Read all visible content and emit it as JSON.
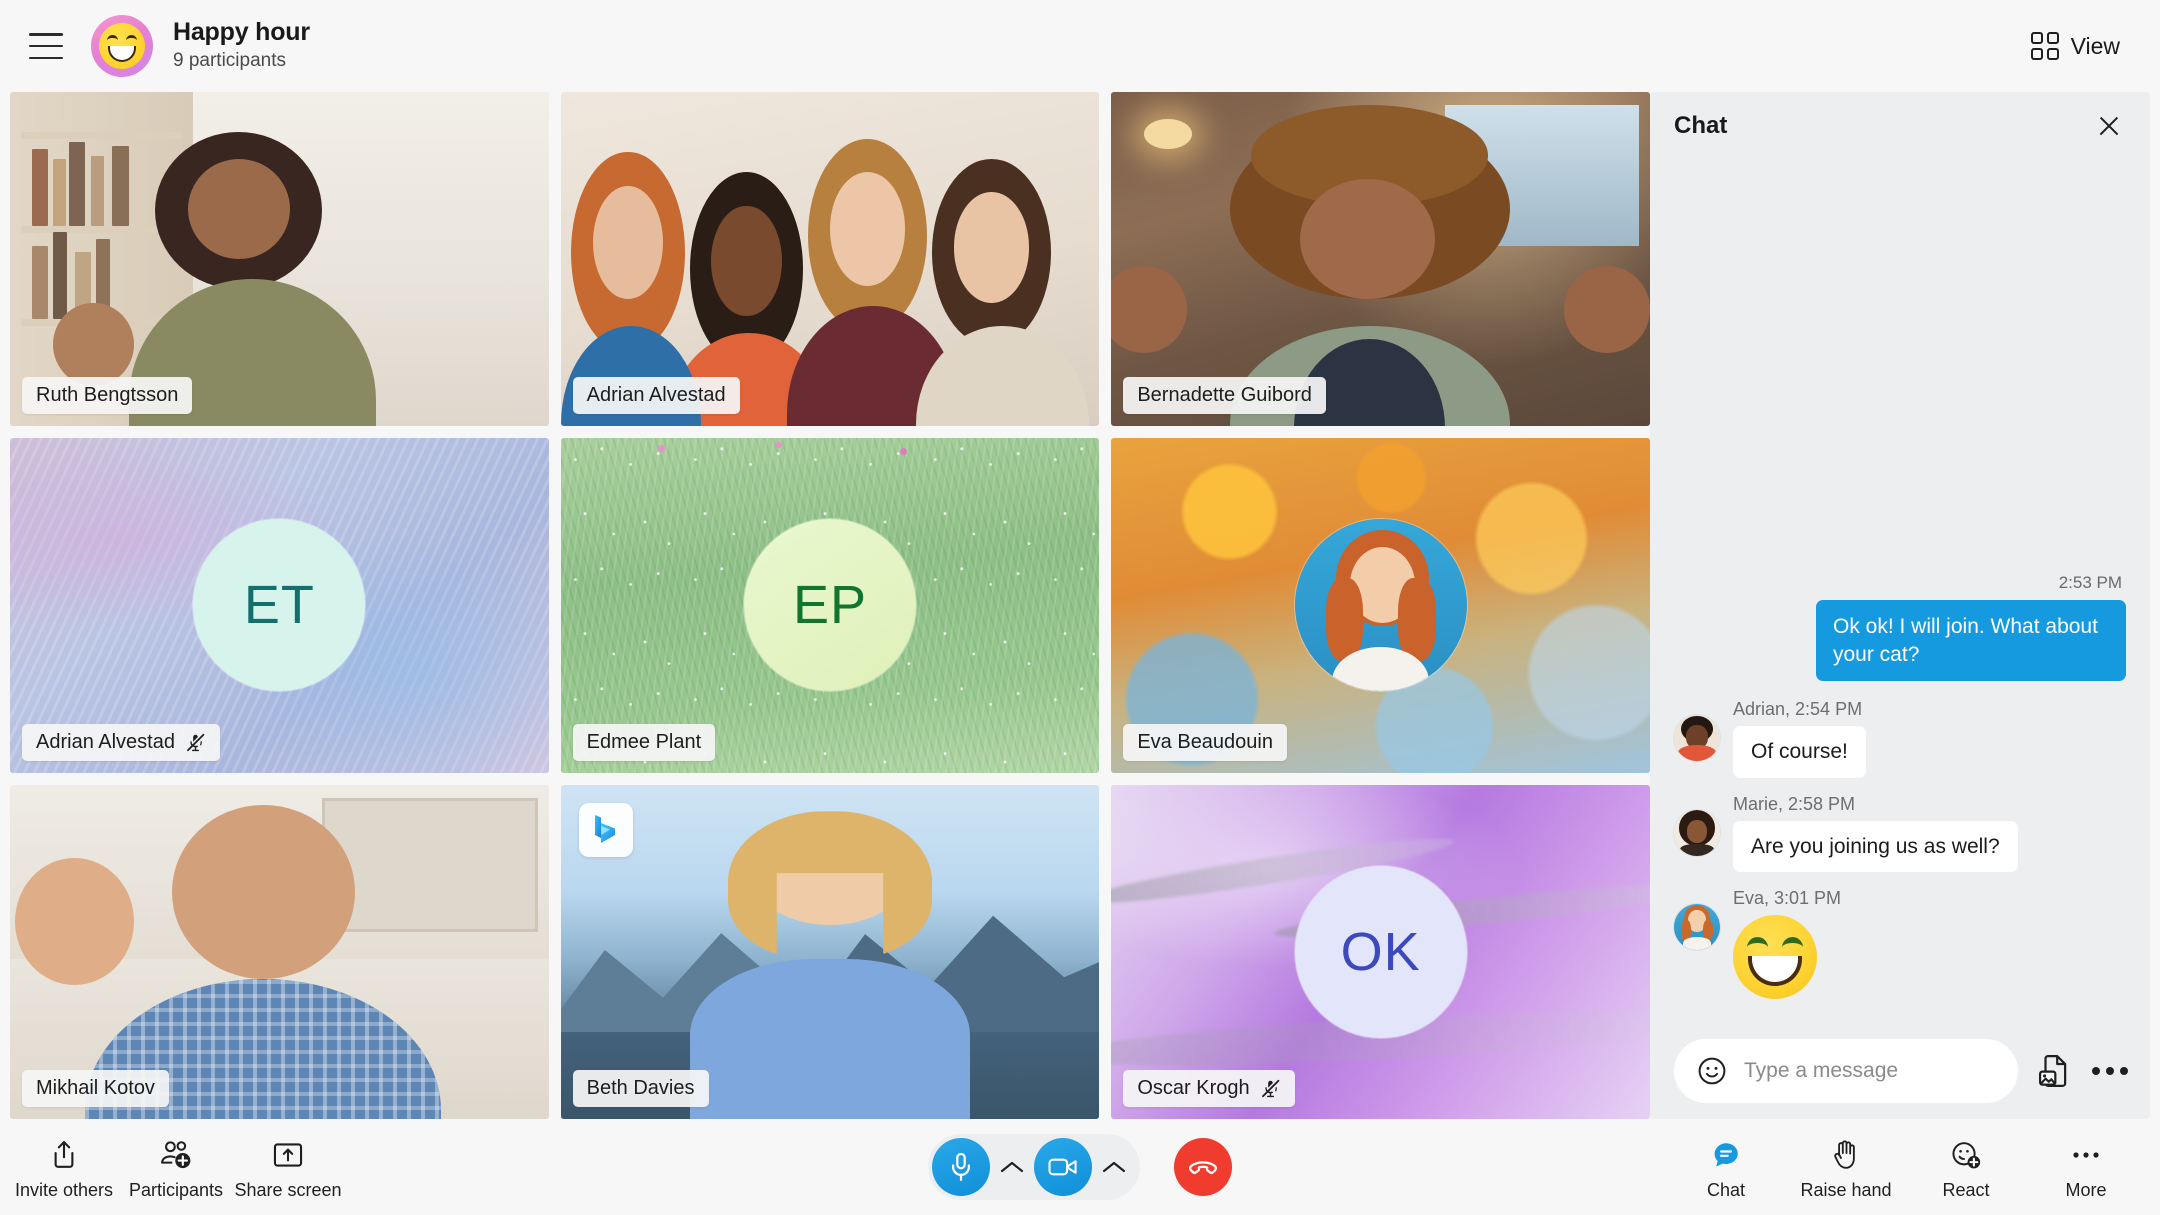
{
  "header": {
    "menu_icon": "hamburger-menu-icon",
    "group_avatar_icon": "smiling-face-group-avatar",
    "title": "Happy hour",
    "participants": "9 participants",
    "view_label": "View",
    "view_icon": "grid-view-icon"
  },
  "tiles": [
    {
      "name": "Ruth Bengtsson",
      "muted": false,
      "kind": "video"
    },
    {
      "name": "Adrian Alvestad",
      "muted": false,
      "kind": "video"
    },
    {
      "name": "Bernadette Guibord",
      "muted": false,
      "kind": "video"
    },
    {
      "name": "Adrian Alvestad",
      "muted": true,
      "kind": "initials",
      "initials": "ET",
      "bg_color": "#b9c4e3",
      "circle_color": "#d6f3ec",
      "text_color": "#14706d"
    },
    {
      "name": "Edmee Plant",
      "muted": false,
      "kind": "initials",
      "initials": "EP",
      "bg_color": "#98c88f",
      "circle_color": "#e2f5c2",
      "text_color": "#10762f"
    },
    {
      "name": "Eva Beaudouin",
      "muted": false,
      "kind": "avatar-photo"
    },
    {
      "name": "Mikhail Kotov",
      "muted": false,
      "kind": "video"
    },
    {
      "name": "Beth Davies",
      "muted": false,
      "kind": "video",
      "badge": "bing-logo-badge"
    },
    {
      "name": "Oscar Krogh",
      "muted": true,
      "kind": "initials",
      "initials": "OK",
      "bg_color": "#c894e6",
      "circle_color": "#e3e6fa",
      "text_color": "#3b49bd"
    }
  ],
  "chat": {
    "title": "Chat",
    "close_icon": "close-icon",
    "messages": [
      {
        "direction": "out",
        "time": "2:53 PM",
        "text": "Ok ok! I will join. What about your cat?"
      },
      {
        "direction": "in",
        "meta": "Adrian, 2:54 PM",
        "text": "Of course!",
        "avatar": "adrian-avatar"
      },
      {
        "direction": "in",
        "meta": "Marie, 2:58 PM",
        "text": "Are you joining us as well?",
        "avatar": "marie-avatar"
      },
      {
        "direction": "in",
        "meta": "Eva, 3:01 PM",
        "emoji": "grinning-face-emoji",
        "avatar": "eva-avatar"
      }
    ],
    "compose": {
      "emoji_icon": "smiley-icon",
      "placeholder": "Type a message",
      "value": "",
      "attach_icon": "image-file-icon",
      "more_icon": "more-options-icon"
    }
  },
  "bottombar": {
    "left": [
      {
        "label": "Invite others",
        "icon": "share-upload-icon"
      },
      {
        "label": "Participants",
        "icon": "people-add-icon"
      },
      {
        "label": "Share screen",
        "icon": "screen-share-icon"
      }
    ],
    "center": [
      {
        "name": "microphone-button",
        "icon": "microphone-icon",
        "state": "on"
      },
      {
        "name": "microphone-options",
        "icon": "chevron-up-icon"
      },
      {
        "name": "camera-button",
        "icon": "video-camera-icon",
        "state": "on"
      },
      {
        "name": "camera-options",
        "icon": "chevron-up-icon"
      },
      {
        "name": "end-call-button",
        "icon": "end-call-icon"
      }
    ],
    "right": [
      {
        "label": "Chat",
        "icon": "chat-bubble-icon",
        "active": true
      },
      {
        "label": "Raise hand",
        "icon": "raise-hand-icon",
        "active": false
      },
      {
        "label": "React",
        "icon": "react-emoji-add-icon",
        "active": false
      },
      {
        "label": "More",
        "icon": "more-options-icon",
        "active": false
      }
    ]
  },
  "colors": {
    "accent_blue": "#159ae0",
    "end_call_red": "#f03b2f",
    "panel_bg": "#eceeef",
    "app_bg": "#f7f7f8"
  }
}
